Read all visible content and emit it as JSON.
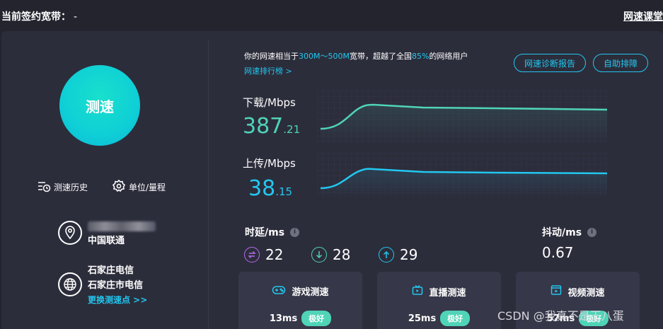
{
  "header": {
    "plan_label": "当前签约宽带：",
    "plan_value": "-",
    "classroom_link": "网速课堂"
  },
  "left": {
    "speed_button": "测速",
    "history_label": "测速历史",
    "units_label": "单位/量程",
    "ip_blurred": "",
    "isp": "中国联通",
    "node_city": "石家庄电信",
    "node_full": "石家庄市电信",
    "change_node": "更换测速点 >>"
  },
  "summary": {
    "prefix": "你的网速相当于",
    "bandwidth": "300M～500M",
    "middle": "宽带，超越了全国",
    "percent": "85%",
    "suffix": "的网络用户",
    "rank_link": "网速排行榜 >"
  },
  "actions": {
    "diagnose": "网速诊断报告",
    "self_help": "自助排障"
  },
  "download": {
    "label": "下载/Mbps",
    "int": "387",
    "dec": ".21"
  },
  "upload": {
    "label": "上传/Mbps",
    "int": "38",
    "dec": ".15"
  },
  "latency": {
    "label": "时延/ms",
    "values": [
      "22",
      "28",
      "29"
    ]
  },
  "jitter": {
    "label": "抖动/ms",
    "value": "0.67"
  },
  "cards": [
    {
      "title": "游戏测速",
      "value": "13ms",
      "grade": "极好"
    },
    {
      "title": "直播测速",
      "value": "25ms",
      "grade": "极好"
    },
    {
      "title": "视频测速",
      "value": "57ms",
      "grade": "极好"
    }
  ],
  "watermark": "CSDN @我真不是王八蛋",
  "colors": {
    "accent_blue": "#22c7f0",
    "accent_green": "#4fd4b7",
    "panel": "#2c2d3b",
    "background": "#23242e"
  }
}
